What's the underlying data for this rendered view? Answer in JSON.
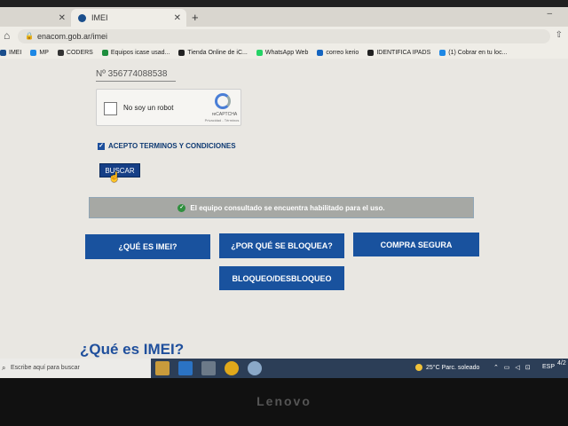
{
  "browser": {
    "tabs": [
      {
        "label": ""
      },
      {
        "label": "IMEI"
      }
    ],
    "new_tab": "+",
    "url": "enacom.gob.ar/imei",
    "bookmarks": [
      {
        "label": "IMEI",
        "color": "#1a4e8c"
      },
      {
        "label": "MP",
        "color": "#1e88e5"
      },
      {
        "label": "CODERS",
        "color": "#333333"
      },
      {
        "label": "Equipos icase usad...",
        "color": "#1e8e3e"
      },
      {
        "label": "Tienda Online de iC...",
        "color": "#222222"
      },
      {
        "label": "WhatsApp Web",
        "color": "#25d366"
      },
      {
        "label": "correo kerio",
        "color": "#1565c0"
      },
      {
        "label": "IDENTIFICA IPADS",
        "color": "#222222"
      },
      {
        "label": "(1) Cobrar en tu loc...",
        "color": "#1e88e5"
      }
    ]
  },
  "form": {
    "serial_value": "Nº 356774088538",
    "captcha_label": "No soy un robot",
    "captcha_brand": "reCAPTCHA",
    "captcha_links": "Privacidad - Términos",
    "terms_label": "ACEPTO TERMINOS Y CONDICIONES",
    "search_button": "BUSCAR"
  },
  "result": {
    "message": "El equipo consultado se encuentra habilitado para el uso."
  },
  "nav_buttons": [
    {
      "label": "¿QUÉ ES IMEI?"
    },
    {
      "label": "¿POR QUÉ SE BLOQUEA?"
    },
    {
      "label": "COMPRA SEGURA"
    },
    {
      "label": "BLOQUEO/DESBLOQUEO"
    }
  ],
  "section_title": "¿Qué es IMEI?",
  "taskbar": {
    "search_placeholder": "Escribe aquí para buscar",
    "weather": "25°C  Parc. soleado",
    "language": "ESP",
    "clock": "4/2"
  },
  "monitor_brand": "Lenovo"
}
